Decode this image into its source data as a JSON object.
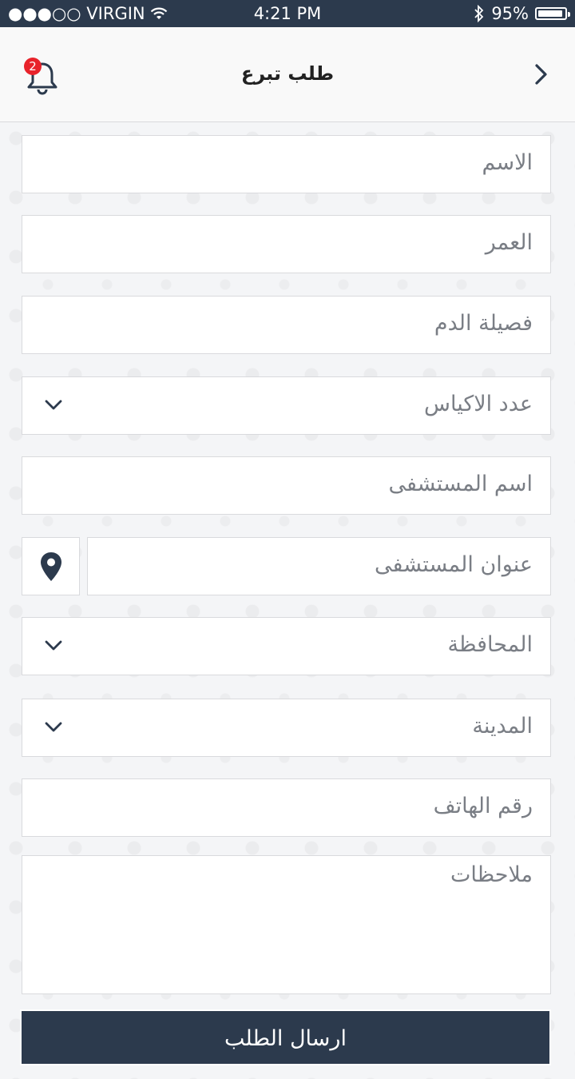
{
  "status_bar": {
    "carrier": "●●●○○ VIRGIN",
    "time": "4:21 PM",
    "battery": "95%",
    "battery_level": 0.95
  },
  "nav": {
    "title": "طلب تبرع",
    "notification_count": "2"
  },
  "form": {
    "name": "الاسم",
    "age": "العمر",
    "blood_type": "فصيلة الدم",
    "bags_count": "عدد الاكياس",
    "hospital_name": "اسم المستشفى",
    "hospital_address": "عنوان المستشفى",
    "governorate": "المحافظة",
    "city": "المدينة",
    "phone": "رقم الهاتف",
    "notes": "ملاحظات"
  },
  "submit_label": "ارسال الطلب",
  "colors": {
    "header_dark": "#2c3a4d",
    "badge_red": "#e8232b"
  }
}
